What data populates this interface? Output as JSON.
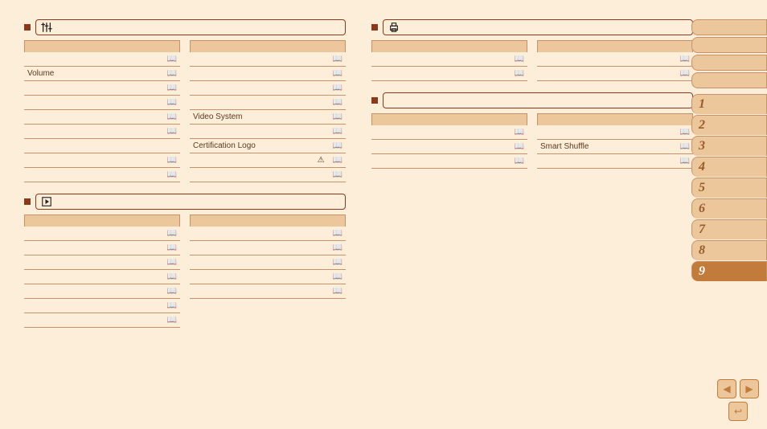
{
  "sections": {
    "settings": {
      "title": "",
      "left": [
        {
          "label": "",
          "icon": false
        },
        {
          "label": "",
          "icon": true
        },
        {
          "label": "Volume",
          "icon": true
        },
        {
          "label": "",
          "icon": true
        },
        {
          "label": "",
          "icon": true
        },
        {
          "label": "",
          "icon": true
        },
        {
          "label": "",
          "icon": true
        },
        {
          "label": "",
          "icon": false
        },
        {
          "label": "",
          "icon": true
        },
        {
          "label": "",
          "icon": true
        }
      ],
      "right": [
        {
          "label": "",
          "icon": false
        },
        {
          "label": "",
          "icon": true
        },
        {
          "label": "",
          "icon": true
        },
        {
          "label": "",
          "icon": true
        },
        {
          "label": "",
          "icon": true
        },
        {
          "label": "Video System",
          "icon": true
        },
        {
          "label": "",
          "icon": true
        },
        {
          "label": "Certification Logo",
          "icon": true
        },
        {
          "label": "",
          "icon": true,
          "extra": "warn"
        },
        {
          "label": "",
          "icon": true
        }
      ]
    },
    "playback": {
      "title": "",
      "left": [
        {
          "label": "",
          "icon": false
        },
        {
          "label": "",
          "icon": true
        },
        {
          "label": "",
          "icon": true
        },
        {
          "label": "",
          "icon": true
        },
        {
          "label": "",
          "icon": true
        },
        {
          "label": "",
          "icon": true
        },
        {
          "label": "",
          "icon": true
        },
        {
          "label": "",
          "icon": true
        }
      ],
      "right": [
        {
          "label": "",
          "icon": false
        },
        {
          "label": "",
          "icon": true
        },
        {
          "label": "",
          "icon": true
        },
        {
          "label": "",
          "icon": true
        },
        {
          "label": "",
          "icon": true
        },
        {
          "label": "",
          "icon": true
        }
      ]
    },
    "print": {
      "title": "",
      "left": [
        {
          "label": "",
          "icon": false
        },
        {
          "label": "",
          "icon": true
        },
        {
          "label": "",
          "icon": true
        }
      ],
      "right": [
        {
          "label": "",
          "icon": false
        },
        {
          "label": "",
          "icon": true
        },
        {
          "label": "",
          "icon": true
        }
      ]
    },
    "other": {
      "title": "",
      "left": [
        {
          "label": "",
          "icon": false
        },
        {
          "label": "",
          "icon": true
        },
        {
          "label": "",
          "icon": true
        },
        {
          "label": "",
          "icon": true
        }
      ],
      "right": [
        {
          "label": "",
          "icon": false
        },
        {
          "label": "",
          "icon": true
        },
        {
          "label": "Smart Shuffle",
          "icon": true
        },
        {
          "label": "",
          "icon": true
        }
      ]
    }
  },
  "sidebar": {
    "blocks": 4,
    "numbers": [
      "1",
      "2",
      "3",
      "4",
      "5",
      "6",
      "7",
      "8",
      "9"
    ],
    "active": "9"
  },
  "nav": {
    "prev": "◀",
    "next": "▶",
    "return": "↩"
  }
}
